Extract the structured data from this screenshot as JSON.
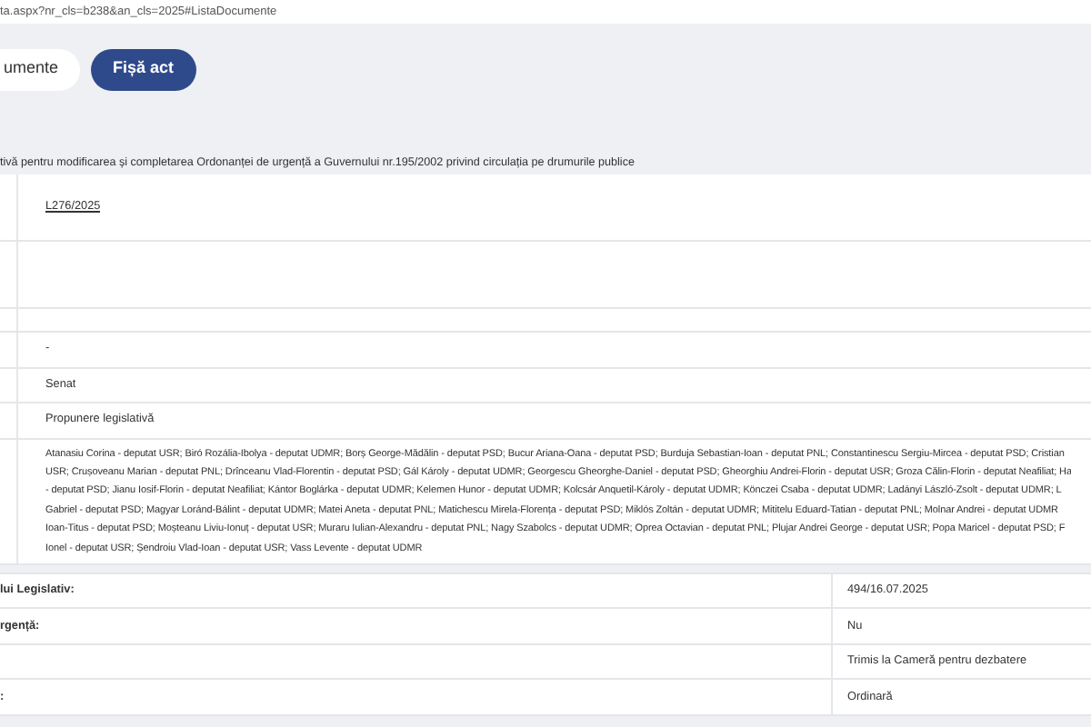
{
  "address_bar": {
    "url": "ta.aspx?nr_cls=b238&an_cls=2025#ListaDocumente"
  },
  "buttons": [
    {
      "label": "umente",
      "selected": false
    },
    {
      "label": "Fișă act",
      "selected": true
    }
  ],
  "title": "tivă pentru modificarea și completarea Ordonanței de urgență a Guvernului nr.195/2002 privind circulația pe drumurile publice",
  "details": [
    {
      "kind": "link",
      "value": "L276/2025"
    },
    {
      "kind": "blank"
    },
    {
      "kind": "blank"
    },
    {
      "kind": "text",
      "value": "-"
    },
    {
      "kind": "text",
      "value": "Senat"
    },
    {
      "kind": "text",
      "value": "Propunere legislativă"
    },
    {
      "kind": "lines",
      "lines": [
        "Atanasiu Corina - deputat USR; Biró Rozália-Ibolya - deputat UDMR; Borș George-Mădălin - deputat PSD; Bucur Ariana-Oana - deputat PSD; Burduja Sebastian-Ioan - deputat PNL; Constantinescu Sergiu-Mircea - deputat PSD; Cristian",
        "USR; Crușoveanu Marian - deputat PNL; Drînceanu Vlad-Florentin - deputat PSD; Gál Károly - deputat UDMR; Georgescu Gheorghe-Daniel - deputat PSD; Gheorghiu Andrei-Florin - deputat USR; Groza Călin-Florin - deputat Neafiliat; Ha",
        "- deputat PSD; Jianu Iosif-Florin - deputat Neafiliat; Kántor Boglárka - deputat UDMR; Kelemen Hunor - deputat UDMR; Kolcsár Anquetil-Károly - deputat UDMR; Könczei Csaba - deputat UDMR; Ladányi László-Zsolt - deputat UDMR; L",
        "Gabriel - deputat PSD; Magyar Loránd-Bálint - deputat UDMR; Matei Aneta - deputat PNL; Matichescu Mirela-Florența - deputat PSD; Miklós Zoltán - deputat UDMR; Mititelu Eduard-Tatian - deputat PNL; Molnar Andrei - deputat UDMR",
        "Ioan-Titus - deputat PSD; Moșteanu Liviu-Ionuț - deputat USR; Muraru Iulian-Alexandru - deputat PNL; Nagy Szabolcs - deputat UDMR; Oprea Octavian - deputat PNL; Plujar Andrei George - deputat USR; Popa Maricel - deputat PSD; F",
        "Ionel - deputat USR; Șendroiu Vlad-Ioan - deputat USR; Vass Levente - deputat UDMR"
      ]
    }
  ],
  "summary_rows": [
    {
      "label": "lui Legislativ:",
      "value": "494/16.07.2025"
    },
    {
      "label": "rgență:",
      "value": "Nu"
    },
    {
      "value": "Trimis la Cameră pentru dezbatere"
    },
    {
      "label": ":",
      "value": "Ordinară"
    }
  ]
}
